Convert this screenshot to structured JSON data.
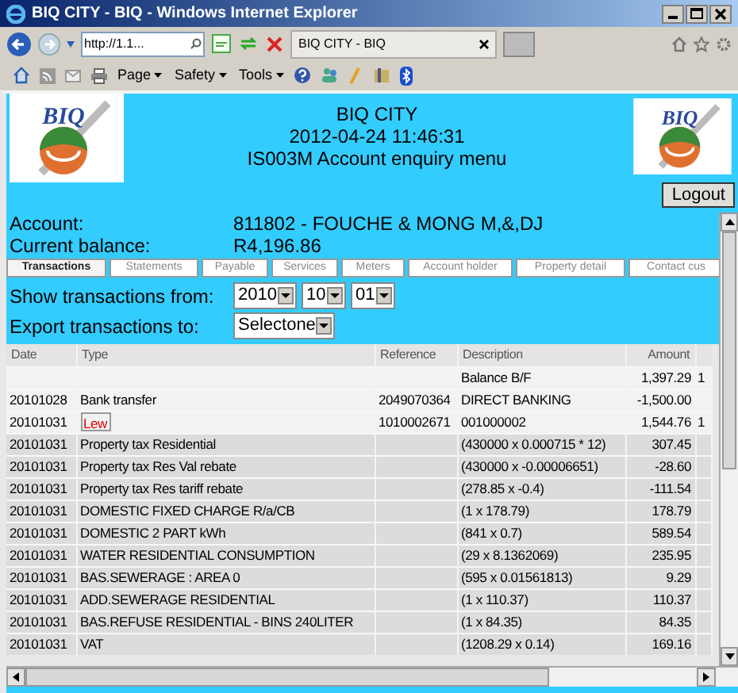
{
  "window": {
    "title": "BIQ CITY - BIQ - Windows Internet Explorer"
  },
  "browser": {
    "address": "http://1.1...",
    "tab": "BIQ CITY - BIQ",
    "commands": [
      "Page",
      "Safety",
      "Tools"
    ]
  },
  "header": {
    "logos": [
      "BIQ",
      "BIQ"
    ],
    "lines": [
      "BIQ CITY",
      "2012-04-24 11:46:31",
      "IS003M Account enquiry menu"
    ],
    "logout": "Logout"
  },
  "account": [
    {
      "label": "Account:",
      "value": "811802 - FOUCHE & MONG M,&,DJ"
    },
    {
      "label": "Current balance:",
      "value": "R4,196.86"
    }
  ],
  "tabs": [
    {
      "label": "Transactions",
      "selected": true
    },
    {
      "label": "Statements",
      "selected": false
    },
    {
      "label": "Payable",
      "selected": false
    },
    {
      "label": "Services",
      "selected": false
    },
    {
      "label": "Meters",
      "selected": false
    },
    {
      "label": "Account holder",
      "selected": false
    },
    {
      "label": "Property detail",
      "selected": false
    },
    {
      "label": "Contact cus",
      "selected": false
    }
  ],
  "filters": {
    "show_label": "Show transactions from:",
    "year": "2010",
    "month": "10",
    "day": "01",
    "export_label": "Export transactions to:",
    "export_value": "Selectone"
  },
  "table": {
    "columns": [
      "Date",
      "Type",
      "Reference",
      "Description",
      "Amount"
    ],
    "rows": [
      {
        "date": "",
        "type": "",
        "reference": "",
        "description": "Balance B/F",
        "amount": "1,397.29",
        "column_6": "1",
        "shaded": false,
        "link": false
      },
      {
        "date": "20101028",
        "type": "Bank transfer",
        "reference": "2049070364",
        "description": "DIRECT BANKING",
        "amount": "-1,500.00",
        "column_6": "",
        "shaded": false,
        "link": false
      },
      {
        "date": "20101031",
        "type": "Lew",
        "reference": "1010002671",
        "description": "001000002",
        "amount": "1,544.76",
        "column_6": "1",
        "shaded": false,
        "link": true
      },
      {
        "date": "20101031",
        "type": "Property tax Residential",
        "reference": "",
        "description": "(430000 x 0.000715 * 12)",
        "amount": "307.45",
        "column_6": "",
        "shaded": true,
        "link": false
      },
      {
        "date": "20101031",
        "type": "Property tax Res Val rebate",
        "reference": "",
        "description": "(430000 x -0.00006651)",
        "amount": "-28.60",
        "column_6": "",
        "shaded": true,
        "link": false
      },
      {
        "date": "20101031",
        "type": "Property tax Res tariff rebate",
        "reference": "",
        "description": "(278.85 x -0.4)",
        "amount": "-111.54",
        "column_6": "",
        "shaded": true,
        "link": false
      },
      {
        "date": "20101031",
        "type": "DOMESTIC FIXED CHARGE R/a/CB",
        "reference": "",
        "description": "(1 x 178.79)",
        "amount": "178.79",
        "column_6": "",
        "shaded": true,
        "link": false
      },
      {
        "date": "20101031",
        "type": "DOMESTIC 2 PART kWh",
        "reference": "",
        "description": "(841 x 0.7)",
        "amount": "589.54",
        "column_6": "",
        "shaded": true,
        "link": false
      },
      {
        "date": "20101031",
        "type": "WATER RESIDENTIAL CONSUMPTION",
        "reference": "",
        "description": "(29 x 8.1362069)",
        "amount": "235.95",
        "column_6": "",
        "shaded": true,
        "link": false
      },
      {
        "date": "20101031",
        "type": "BAS.SEWERAGE : AREA 0",
        "reference": "",
        "description": "(595 x 0.01561813)",
        "amount": "9.29",
        "column_6": "",
        "shaded": true,
        "link": false
      },
      {
        "date": "20101031",
        "type": "ADD.SEWERAGE RESIDENTIAL",
        "reference": "",
        "description": "(1 x 110.37)",
        "amount": "110.37",
        "column_6": "",
        "shaded": true,
        "link": false
      },
      {
        "date": "20101031",
        "type": "BAS.REFUSE RESIDENTIAL - BINS 240LITER",
        "reference": "",
        "description": "(1 x 84.35)",
        "amount": "84.35",
        "column_6": "",
        "shaded": true,
        "link": false
      },
      {
        "date": "20101031",
        "type": "VAT",
        "reference": "",
        "description": "(1208.29 x 0.14)",
        "amount": "169.16",
        "column_6": "",
        "shaded": true,
        "link": false
      }
    ]
  }
}
